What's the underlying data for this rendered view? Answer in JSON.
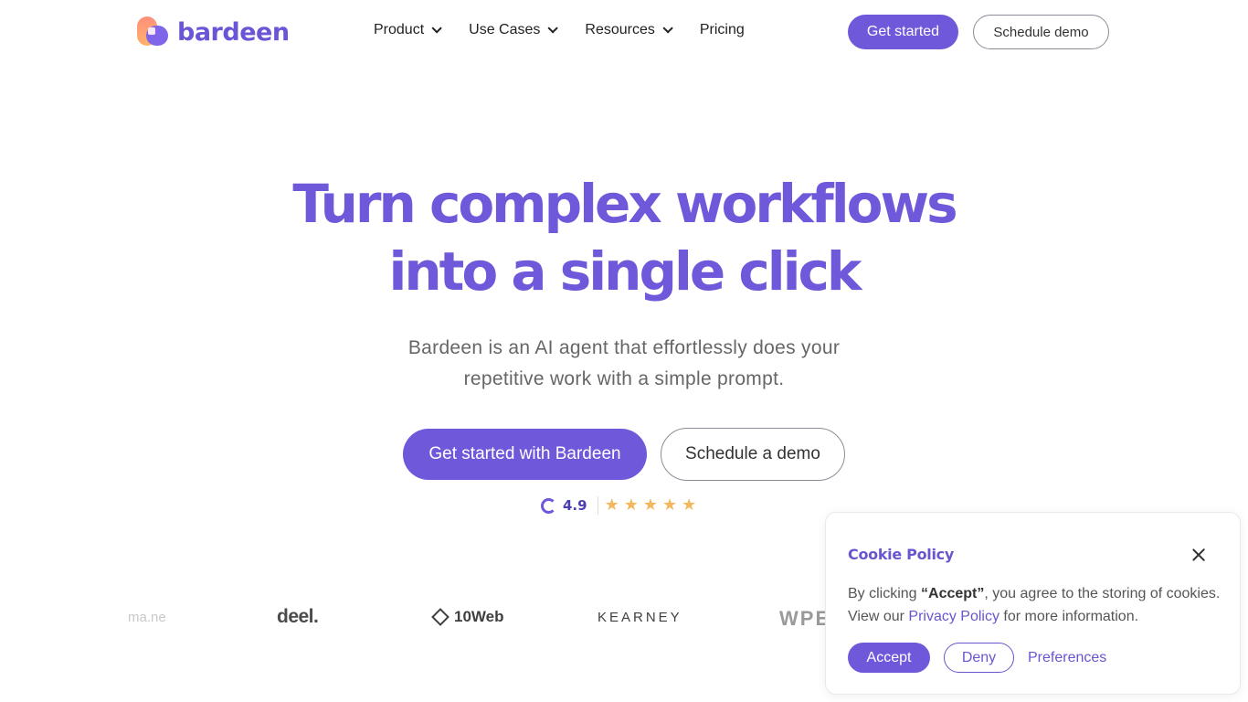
{
  "nav": {
    "logo_text": "bardeen",
    "menu": {
      "product": "Product",
      "use_cases": "Use Cases",
      "resources": "Resources",
      "pricing": "Pricing"
    },
    "get_started": "Get started",
    "schedule_demo": "Schedule demo"
  },
  "hero": {
    "title_line1": "Turn complex workflows",
    "title_line2": "into a single click",
    "subtitle_line1": "Bardeen is an AI agent that effortlessly does your",
    "subtitle_line2": "repetitive work with a simple prompt.",
    "primary_cta": "Get started with Bardeen",
    "secondary_cta": "Schedule a demo",
    "rating": "4.9",
    "stars": 5,
    "star_glyph": "★"
  },
  "logos": {
    "partial_left": "ma.ne",
    "deel": "deel.",
    "tenweb": "10Web",
    "kearney": "KEARNEY",
    "partial_right": "WPE"
  },
  "cookie": {
    "title": "Cookie Policy",
    "text_prefix": "By clicking ",
    "text_accept_word": "“Accept”",
    "text_middle": ", you agree to the storing of cookies. View our ",
    "privacy_link": "Privacy Policy",
    "text_suffix": " for more information.",
    "accept": "Accept",
    "deny": "Deny",
    "preferences": "Preferences"
  },
  "colors": {
    "brand_purple": "#6f58d9",
    "star_gold": "#f3b75e"
  }
}
